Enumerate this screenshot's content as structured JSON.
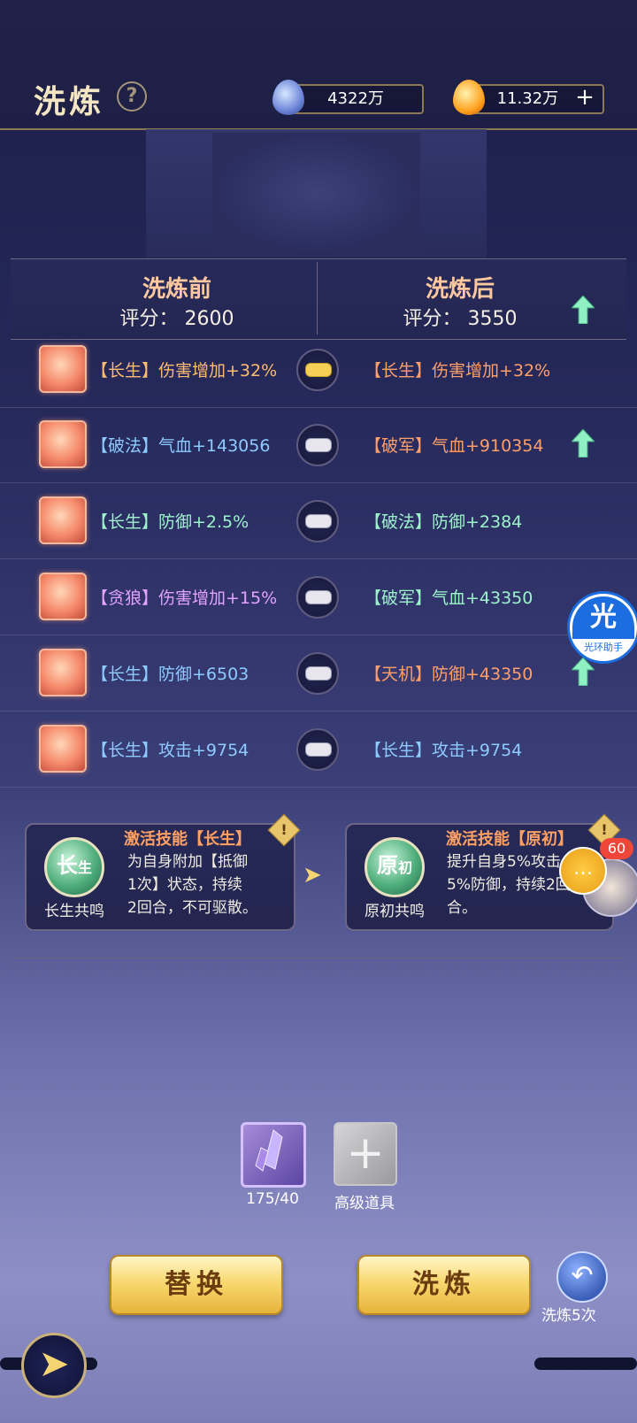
{
  "header": {
    "title": "洗炼",
    "help_icon": "question-icon",
    "currency1": {
      "icon": "crystal-icon",
      "value": "4322万"
    },
    "currency2": {
      "icon": "flame-icon",
      "value": "11.32万",
      "add_icon": "plus-icon"
    }
  },
  "scores": {
    "before_title": "洗炼前",
    "before_score": "评分：  2600",
    "after_title": "洗炼后",
    "after_score": "评分：  3550"
  },
  "rows": [
    {
      "left": "【长生】伤害增加+32%",
      "left_color": "gold",
      "locked": true,
      "right": "【长生】伤害增加+32%",
      "right_color": "orange",
      "up": false
    },
    {
      "left": "【破法】气血+143056",
      "left_color": "blue",
      "locked": false,
      "right": "【破军】气血+910354",
      "right_color": "orange",
      "up": true
    },
    {
      "left": "【长生】防御+2.5%",
      "left_color": "green",
      "locked": false,
      "right": "【破法】防御+2384",
      "right_color": "green",
      "up": false
    },
    {
      "left": "【贪狼】伤害增加+15%",
      "left_color": "purple",
      "locked": false,
      "right": "【破军】气血+43350",
      "right_color": "green",
      "up": false
    },
    {
      "left": "【长生】防御+6503",
      "left_color": "blue",
      "locked": false,
      "right": "【天机】防御+43350",
      "right_color": "orange",
      "up": true
    },
    {
      "left": "【长生】攻击+9754",
      "left_color": "blue",
      "locked": false,
      "right": "【长生】攻击+9754",
      "right_color": "blue",
      "up": false
    }
  ],
  "skills": {
    "left": {
      "orb_main": "长",
      "orb_sub": "生",
      "label": "长生共鸣",
      "title": "激活技能【长生】",
      "desc_lines": [
        "为自身附加【抵御",
        "1次】状态，持续",
        "2回合，不可驱散。"
      ]
    },
    "right": {
      "orb_main": "原",
      "orb_sub": "初",
      "label": "原初共鸣",
      "title": "激活技能【原初】",
      "desc_lines": [
        "提升自身5%攻击",
        "5%防御，持续2回",
        "合。"
      ]
    }
  },
  "items": {
    "item1_count": "175/40",
    "item2_label": "高级道具"
  },
  "buttons": {
    "replace": "替换",
    "refine": "洗炼",
    "undo_label": "洗炼5次"
  },
  "assistant": {
    "icon_text": "光",
    "label": "光环助手"
  },
  "chat": {
    "count": "60"
  },
  "colors": {
    "gold": "#ffbb6e",
    "blue": "#8ecbff",
    "green": "#9ef2cc",
    "purple": "#e3a2ff",
    "orange": "#ff9f6a"
  }
}
